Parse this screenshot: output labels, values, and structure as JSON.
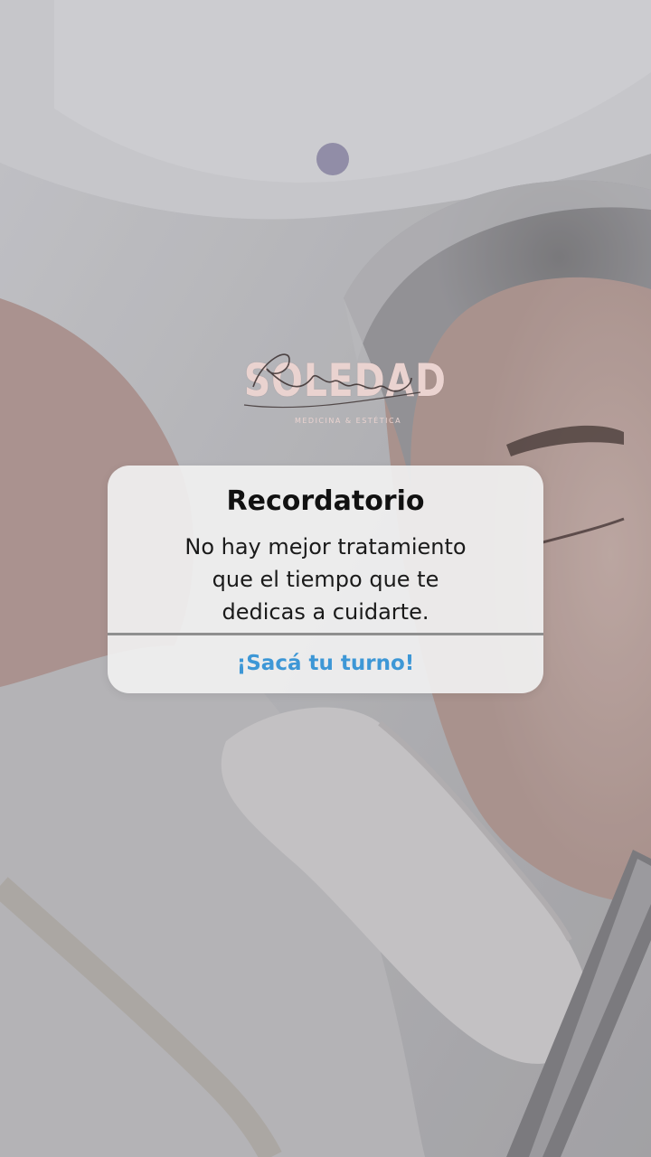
{
  "logo": {
    "brand": "SOLEDAD",
    "script_text": "Pelaez",
    "tagline": "MEDICINA & ESTÉTICA",
    "color": "#ead3d0"
  },
  "reminder_card": {
    "title": "Recordatorio",
    "message_lines": [
      "No hay mejor tratamiento",
      "que el tiempo que te",
      "dedicas a cuidarte."
    ],
    "action_label": "¡Sacá tu turno!",
    "action_color": "#3d97d6"
  },
  "background": {
    "description_icon": "photo-background"
  }
}
